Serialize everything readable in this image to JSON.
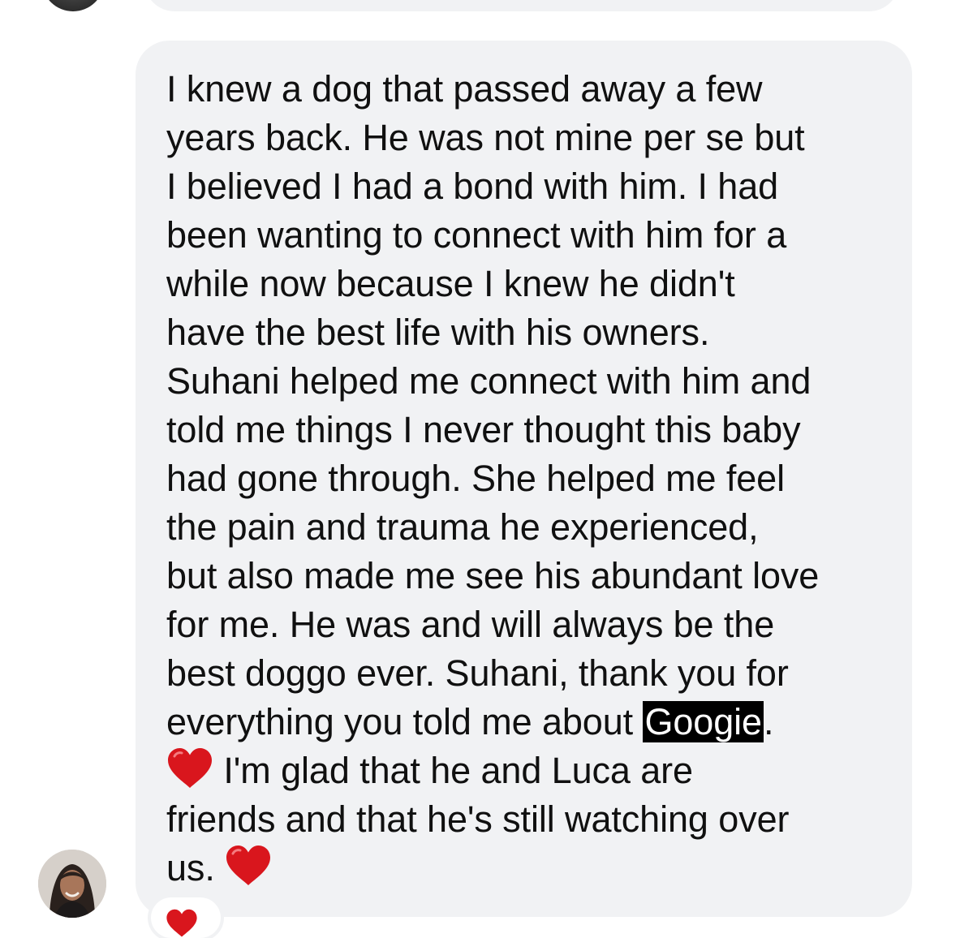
{
  "colors": {
    "bubble": "#f1f2f4",
    "text": "#101010",
    "highlight_bg": "#000000",
    "highlight_text": "#ffffff",
    "heart": "#d9161d"
  },
  "icons": {
    "heart": "red-heart-emoji",
    "reaction": "red-heart-emoji"
  },
  "message": {
    "lines": [
      "I knew a dog that passed away a few",
      "years back. He was not mine per se but",
      "I believed I had a bond with him. I had",
      "been wanting to connect with him for a",
      "while now because I knew he didn't",
      "have the best life with his owners.",
      "Suhani helped me connect with him and",
      "told me things I never thought this baby",
      "had gone through. She helped me feel",
      "the pain and trauma he experienced,",
      "but also made me see his abundant love",
      "for me. He was and will always be the",
      "best doggo ever. Suhani, thank you for"
    ],
    "line14_before": "everything you told me about ",
    "highlighted_word": "Googie",
    "line14_after": ".",
    "line15_after_heart": " I'm glad that he and Luca are",
    "line16": "friends and that he's still watching over",
    "line17_before_heart": "us. "
  }
}
